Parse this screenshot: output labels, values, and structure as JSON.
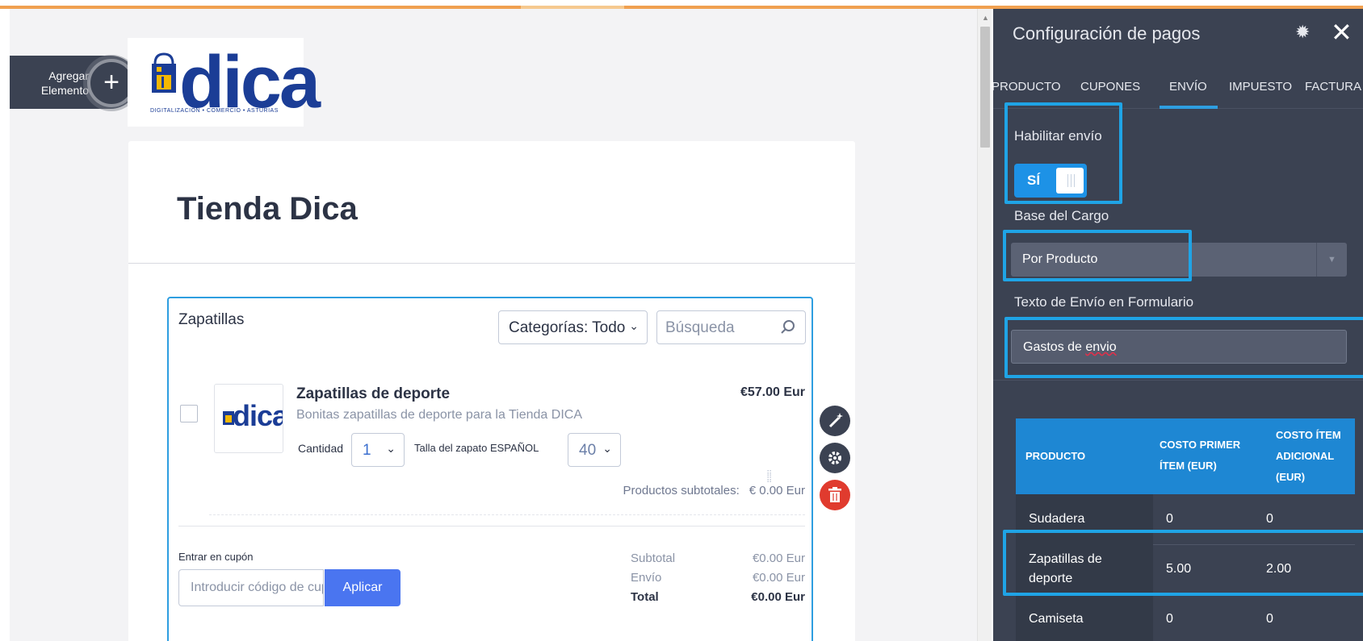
{
  "builder": {
    "add_element_label_1": "Agregar",
    "add_element_label_2": "Elemento",
    "add_element_symbol": "+"
  },
  "logo": {
    "text": "dica",
    "tagline": "DIGITALIZACIÓN • COMERCIO • ASTURIAS",
    "color": "#1b3d96"
  },
  "form": {
    "title": "Tienda Dica",
    "product_list": {
      "heading": "Zapatillas",
      "category_select": "Categorías: Todo",
      "search_placeholder": "Búsqueda",
      "item": {
        "name": "Zapatillas de deporte",
        "description": "Bonitas zapatillas de deporte para la Tienda DICA",
        "price": "€57.00 Eur",
        "quantity_label": "Cantidad",
        "quantity_value": "1",
        "size_label": "Talla del zapato ESPAÑOL",
        "size_value": "40",
        "thumb_text": "dica"
      },
      "products_subtotal_label": "Productos subtotales:",
      "products_subtotal_value": "€ 0.00 Eur"
    },
    "coupon": {
      "label": "Entrar en cupón",
      "placeholder": "Introducir código de cupón",
      "apply_label": "Aplicar"
    },
    "totals": [
      {
        "label": "Subtotal",
        "value": "€0.00 Eur"
      },
      {
        "label": "Envío",
        "value": "€0.00 Eur"
      },
      {
        "label": "Total",
        "value": "€0.00 Eur"
      }
    ]
  },
  "panel": {
    "title": "Configuración de pagos",
    "tabs": [
      "PRODUCTO",
      "CUPONES",
      "ENVÍO",
      "IMPUESTO",
      "FACTURA"
    ],
    "active_tab": "ENVÍO",
    "enable_shipping_label": "Habilitar envío",
    "enable_shipping_value": "SÍ",
    "charge_base_label": "Base del Cargo",
    "charge_base_value": "Por Producto",
    "shipping_text_label": "Texto de Envío en Formulario",
    "shipping_text_value_1": "Gastos de ",
    "shipping_text_value_2": "envio",
    "table": {
      "headers": [
        "PRODUCTO",
        "COSTO PRIMER ÍTEM (EUR)",
        "COSTO ÍTEM ADICIONAL (EUR)"
      ],
      "rows": [
        {
          "product": "Sudadera",
          "first": "0",
          "additional": "0"
        },
        {
          "product": "Zapatillas de deporte",
          "first": "5.00",
          "additional": "2.00"
        },
        {
          "product": "Camiseta",
          "first": "0",
          "additional": "0"
        }
      ]
    }
  },
  "colors": {
    "accent": "#1d92e6",
    "highlight": "#1fa4e6",
    "panel_bg": "#3b4252",
    "apply_button": "#4a75f0",
    "delete": "#e03b2e"
  }
}
